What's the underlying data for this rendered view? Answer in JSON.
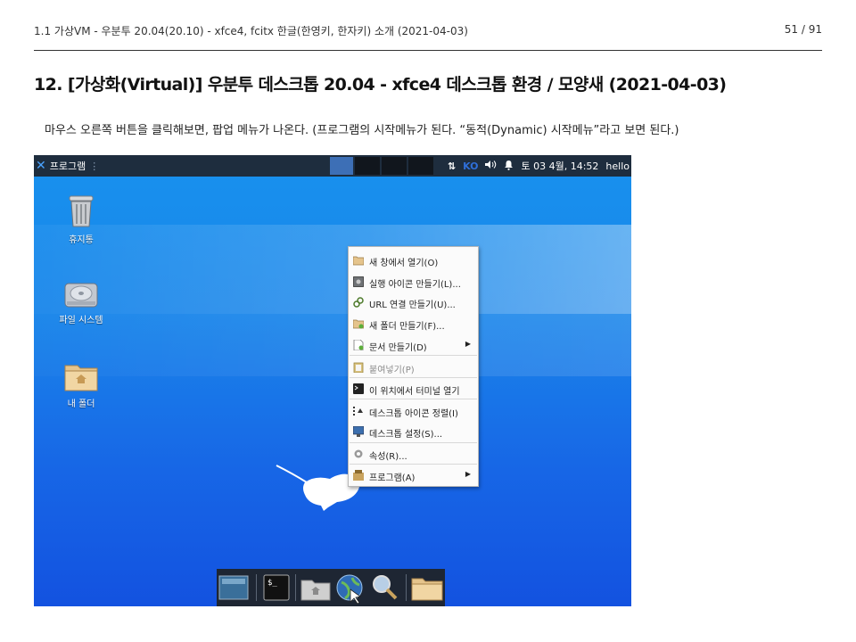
{
  "doc": {
    "header_left": "1.1 가상VM - 우분투 20.04(20.10) - xfce4, fcitx 한글(한영키, 한자키) 소개 (2021-04-03)",
    "page_number": "51 / 91",
    "section_title": "12. [가상화(Virtual)] 우분투 데스크톱 20.04 - xfce4 데스크톱 환경 / 모양새 (2021-04-03)",
    "description": "마우스 오른쪽 버튼을 클릭해보면, 팝업 메뉴가 나온다. (프로그램의 시작메뉴가 된다. “동적(Dynamic) 시작메뉴”라고 보면 된다.)"
  },
  "panel": {
    "menu_label": "프로그램",
    "input_method": "KO",
    "clock": "토 03 4월, 14:52",
    "user": "hello"
  },
  "desktop_icons": [
    {
      "label": "휴지통",
      "icon": "trash-icon"
    },
    {
      "label": "파일 시스템",
      "icon": "drive-icon"
    },
    {
      "label": "내 폴더",
      "icon": "home-folder-icon"
    }
  ],
  "context_menu": {
    "items": [
      {
        "label": "새 창에서 열기(O)",
        "icon": "folder-open-icon"
      },
      {
        "label": "실행 아이콘 만들기(L)...",
        "icon": "launcher-icon"
      },
      {
        "label": "URL 연결 만들기(U)...",
        "icon": "link-icon"
      },
      {
        "label": "새 폴더 만들기(F)...",
        "icon": "folder-new-icon"
      },
      {
        "label": "문서 만들기(D)",
        "icon": "document-new-icon"
      },
      {
        "label": "붙여넣기(P)",
        "icon": "paste-icon"
      },
      {
        "label": "이 위치에서 터미널 열기",
        "icon": "terminal-icon"
      },
      {
        "label": "데스크톱 아이콘 정렬(I)",
        "icon": "sort-icon"
      },
      {
        "label": "데스크톱 설정(S)...",
        "icon": "monitor-icon"
      },
      {
        "label": "속성(R)...",
        "icon": "gear-icon"
      },
      {
        "label": "프로그램(A)",
        "icon": "applications-icon"
      }
    ]
  },
  "dock": {
    "items": [
      {
        "icon": "show-desktop-icon"
      },
      {
        "icon": "terminal-icon"
      },
      {
        "icon": "home-folder-icon"
      },
      {
        "icon": "web-browser-icon"
      },
      {
        "icon": "search-icon"
      },
      {
        "icon": "folder-icon"
      }
    ]
  },
  "colors": {
    "panel_bg": "#1e2d3e",
    "desktop_top": "#1791ee",
    "desktop_bottom": "#1352e0",
    "menu_bg": "#fbfbfb"
  }
}
